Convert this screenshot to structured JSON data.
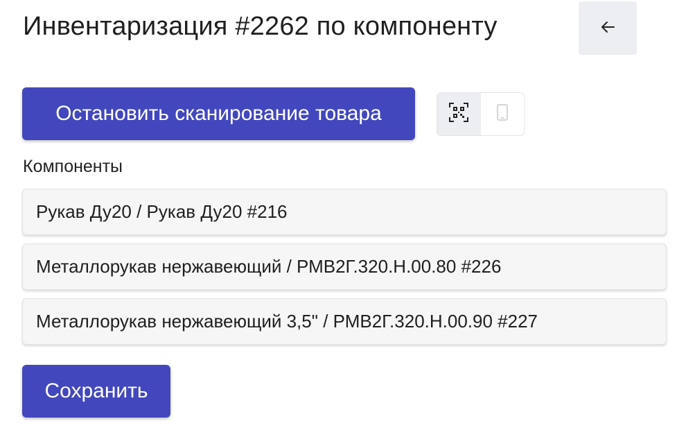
{
  "header": {
    "title": "Инвентаризация #2262 по компоненту",
    "back_icon": "arrow-left-icon"
  },
  "actions": {
    "stop_scan_label": "Остановить сканирование товара",
    "save_label": "Сохранить"
  },
  "scan_mode_toggle": {
    "options": [
      {
        "icon": "qr-code-icon",
        "active": true
      },
      {
        "icon": "phone-icon",
        "active": false
      }
    ]
  },
  "components": {
    "label": "Компоненты",
    "items": [
      "Рукав Ду20 / Рукав Ду20 #216",
      "Металлорукав нержавеющий / РМВ2Г.320.Н.00.80 #226",
      "Металлорукав нержавеющий 3,5\" / РМВ2Г.320.Н.00.90 #227"
    ]
  },
  "colors": {
    "primary": "#4347bd",
    "toggle_active_bg": "#eceef1",
    "item_bg": "#f6f6f6"
  }
}
